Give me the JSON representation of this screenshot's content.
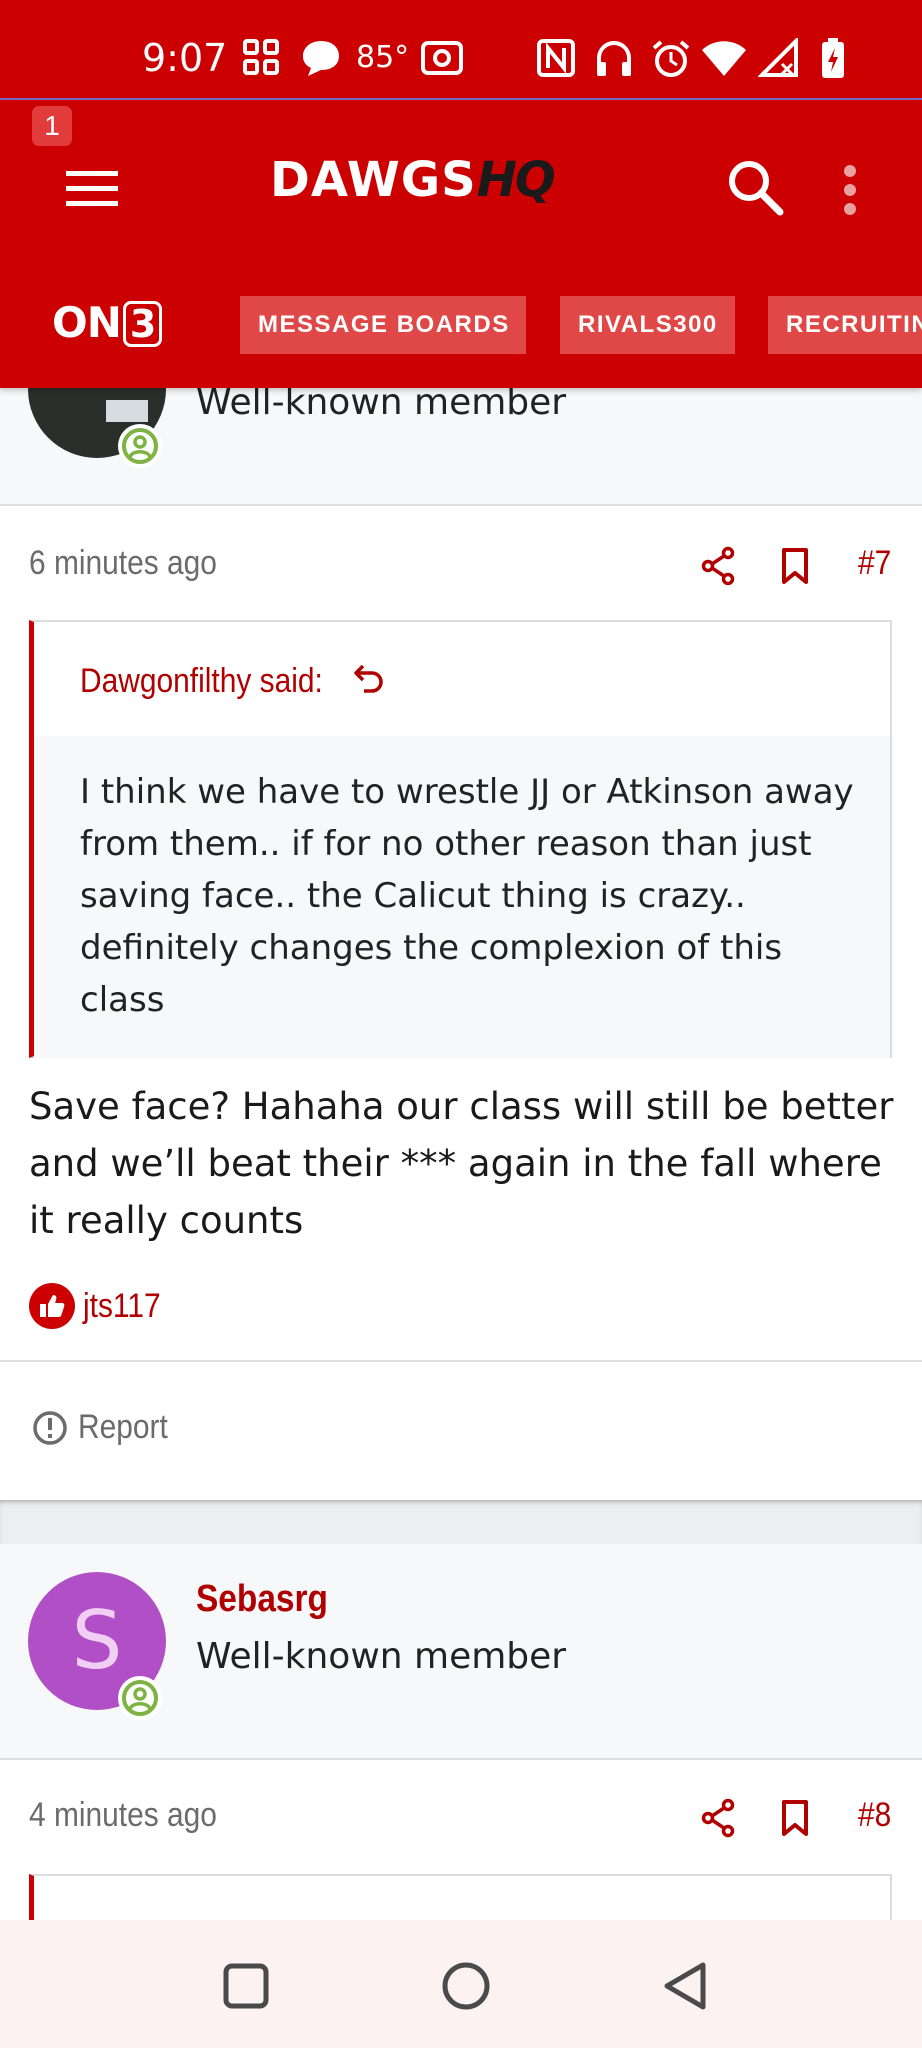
{
  "status_bar": {
    "time": "9:07",
    "temperature": "85°",
    "icons": [
      "apps-grid-icon",
      "chat-bubble-icon",
      "hotspot-icon",
      "nfc-icon",
      "headphones-icon",
      "alarm-icon",
      "wifi-icon",
      "signal-icon",
      "battery-charging-icon"
    ]
  },
  "header": {
    "notification_count": "1",
    "logo_main": "DAWGS",
    "logo_accent": "HQ",
    "brand_logo": "ON3",
    "nav_chips": [
      "MESSAGE BOARDS",
      "RIVALS300",
      "RECRUITING"
    ]
  },
  "post7": {
    "member_title": "Well-known member",
    "time_ago": "6 minutes ago",
    "post_number": "#7",
    "quote_author": "Dawgonfilthy said:",
    "quote_text": "I think we have to wrestle JJ or Atkinson away from them.. if for no other reason than just saving face.. the Calicut thing is crazy.. definitely changes the complexion of this class",
    "body": "Save face? Hahaha our class will still be better and we’ll beat their *** again in the fall where it really counts",
    "reaction_user": "jts117",
    "report_label": "Report"
  },
  "post8": {
    "avatar_letter": "S",
    "member_name": "Sebasrg",
    "member_title": "Well-known member",
    "time_ago": "4 minutes ago",
    "post_number": "#8"
  },
  "colors": {
    "brand_red": "#cc0000",
    "link_red": "#b00000",
    "avatar_purple": "#b04fc6",
    "online_green": "#7cb342"
  }
}
